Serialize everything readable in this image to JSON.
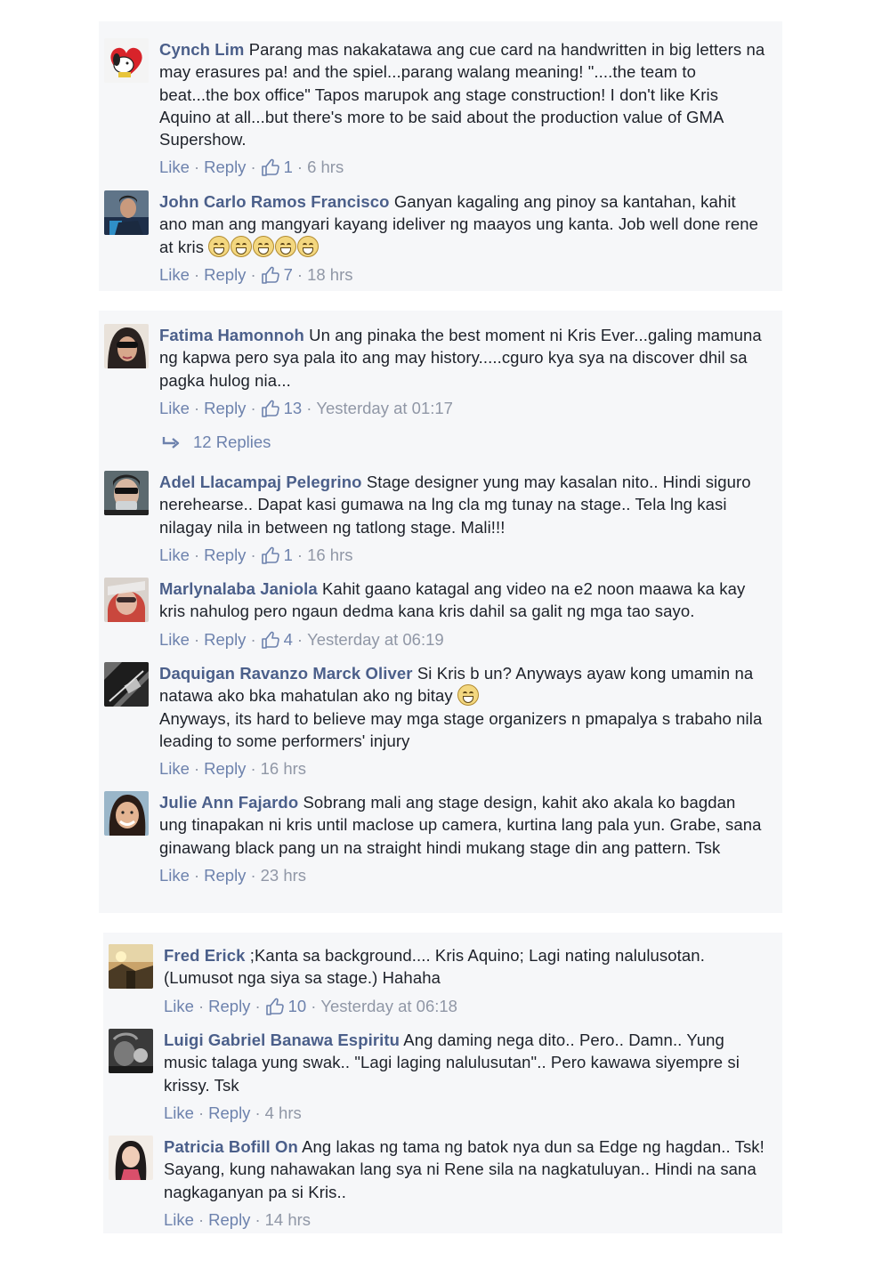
{
  "labels": {
    "like": "Like",
    "reply": "Reply"
  },
  "cards": [
    {
      "comments": [
        {
          "name": "Cynch Lim",
          "text": "Parang mas nakakatawa ang cue card na handwritten in big letters na may erasures pa! and the spiel...parang walang meaning! \"....the team to beat...the box office\" Tapos marupok ang stage construction! I don't like Kris Aquino at all...but there's more to be said about the production value of GMA Supershow.",
          "likes": "1",
          "time": "6 hrs"
        },
        {
          "name": "John Carlo Ramos Francisco",
          "text": "Ganyan kagaling ang pinoy sa kantahan, kahit ano man ang mangyari kayang ideliver ng maayos ung kanta. Job well done rene at kris",
          "likes": "7",
          "time": "18 hrs"
        }
      ]
    },
    {
      "comments": [
        {
          "name": "Fatima Hamonnoh",
          "text": "Un ang pinaka the best moment ni Kris Ever...galing mamuna ng kapwa pero sya pala ito ang may history.....cguro kya sya na discover dhil sa pagka hulog nia...",
          "likes": "13",
          "time": "Yesterday at 01:17",
          "replies": "12 Replies"
        },
        {
          "name": "Adel Llacampaj Pelegrino",
          "text": "Stage designer yung may kasalan nito.. Hindi siguro nerehearse.. Dapat kasi gumawa na lng cla mg tunay na stage.. Tela lng kasi nilagay nila in between ng tatlong stage. Mali!!!",
          "likes": "1",
          "time": "16 hrs"
        },
        {
          "name": "Marlynalaba Janiola",
          "text": "Kahit gaano katagal ang video na e2 noon maawa ka kay kris nahulog pero ngaun dedma kana kris dahil sa galit ng mga tao sayo.",
          "likes": "4",
          "time": "Yesterday at 06:19"
        },
        {
          "name": "Daquigan Ravanzo Marck Oliver",
          "text": "Si Kris b un? Anyways ayaw kong umamin na natawa ako bka mahatulan ako ng bitay",
          "text2": "Anyways, its hard to believe may mga stage organizers n pmapalya s trabaho nila leading to some performers' injury",
          "likes": "",
          "time": "16 hrs"
        },
        {
          "name": "Julie Ann Fajardo",
          "text": "Sobrang mali ang stage design, kahit ako akala ko bagdan ung tinapakan ni kris until maclose up camera, kurtina lang pala yun. Grabe, sana ginawang black pang un na straight hindi mukang stage din ang pattern. Tsk",
          "likes": "",
          "time": "23 hrs"
        }
      ]
    },
    {
      "comments": [
        {
          "name": "Fred Erick",
          "text": ";Kanta sa background.... Kris Aquino; Lagi nating nalulusotan. (Lumusot nga siya sa stage.) Hahaha",
          "likes": "10",
          "time": "Yesterday at 06:18"
        },
        {
          "name": "Luigi Gabriel Banawa Espiritu",
          "text": "Ang daming nega dito.. Pero.. Damn.. Yung music talaga yung swak.. \"Lagi laging nalulusutan\".. Pero kawawa siyempre si krissy. Tsk",
          "likes": "",
          "time": "4 hrs"
        },
        {
          "name": "Patricia Bofill On",
          "text": "Ang lakas ng tama ng batok nya dun sa Edge ng hagdan.. Tsk! Sayang, kung nahawakan lang sya ni Rene sila na nagkatuluyan.. Hindi na sana nagkaganyan pa si Kris..",
          "likes": "",
          "time": "14 hrs"
        }
      ]
    }
  ]
}
